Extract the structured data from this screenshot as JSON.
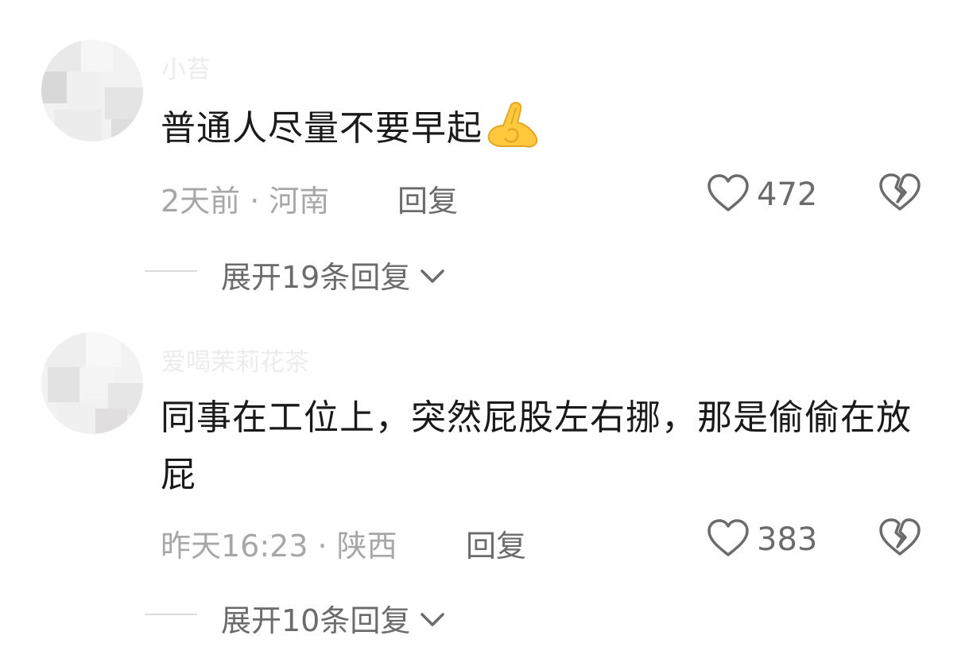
{
  "comments": [
    {
      "username": "小苔",
      "content": "普通人尽量不要早起",
      "emoji_icon": "pinched-fingers-emoji",
      "time": "2天前",
      "location": "河南",
      "reply_label": "回复",
      "like_count": "472",
      "expand_label": "展开19条回复"
    },
    {
      "username": "爱喝茉莉花茶",
      "content": "同事在工位上，突然屁股左右挪，那是偷偷在放屁",
      "time": "昨天16:23",
      "location": "陕西",
      "reply_label": "回复",
      "like_count": "383",
      "expand_label": "展开10条回复"
    }
  ],
  "separator": "·",
  "icons": [
    "heart-icon",
    "broken-heart-icon",
    "chevron-down-icon"
  ],
  "colors": {
    "text": "#1a1a1a",
    "meta": "#a7a7a7",
    "action": "#6b6b6b"
  }
}
